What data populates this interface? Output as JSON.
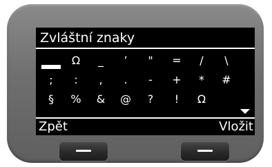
{
  "screen": {
    "title": "Zvláštní znaky"
  },
  "characters": {
    "rows": [
      [
        "",
        "Ω",
        "_",
        "’",
        "\"",
        "=",
        "/",
        "\\"
      ],
      [
        ";",
        ":",
        ",",
        ".",
        "-",
        "+",
        "*",
        "#"
      ],
      [
        "§",
        "%",
        "&",
        "@",
        "?",
        "!",
        "Ω",
        ""
      ]
    ],
    "selected": "space"
  },
  "softkeys": {
    "left": "Zpět",
    "right": "Vložit"
  },
  "icons": {
    "scroll": "scroll-down-arrow-icon",
    "hw_left": "hardware-softkey-left",
    "hw_right": "hardware-softkey-right"
  },
  "colors": {
    "screen_bg": "#000000",
    "text": "#ffffff",
    "device": "#777777"
  }
}
